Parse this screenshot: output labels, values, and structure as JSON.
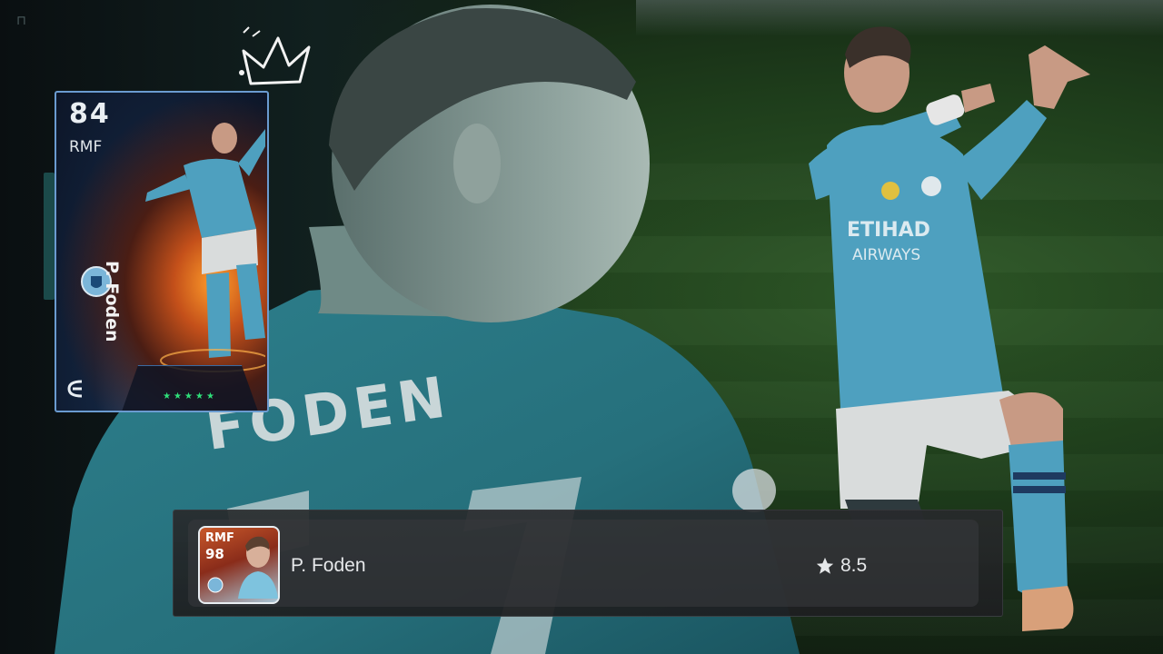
{
  "background": {
    "corner_glyph": "⊓",
    "jersey_back_text": "FODEN",
    "jersey_sponsor_line1": "ETIHAD",
    "jersey_sponsor_line2": "AIRWAYS"
  },
  "player_card": {
    "rating": "84",
    "position": "RMF",
    "name": "P. Foden",
    "stars": "★★★★★",
    "icons": [
      "club-crest-icon",
      "efootball-logo-icon"
    ]
  },
  "selection": {
    "mini_card": {
      "position": "RMF",
      "rating": "98"
    },
    "player_name": "P. Foden",
    "rating_icon": "star-icon",
    "rating_value": "8.5"
  },
  "colors": {
    "kit_blue": "#4ea0bf",
    "pitch_green": "#2f5a28",
    "card_fire": "#ff9d2a",
    "star_green": "#2fe07a",
    "bar_bg": "#2a2c2e"
  }
}
